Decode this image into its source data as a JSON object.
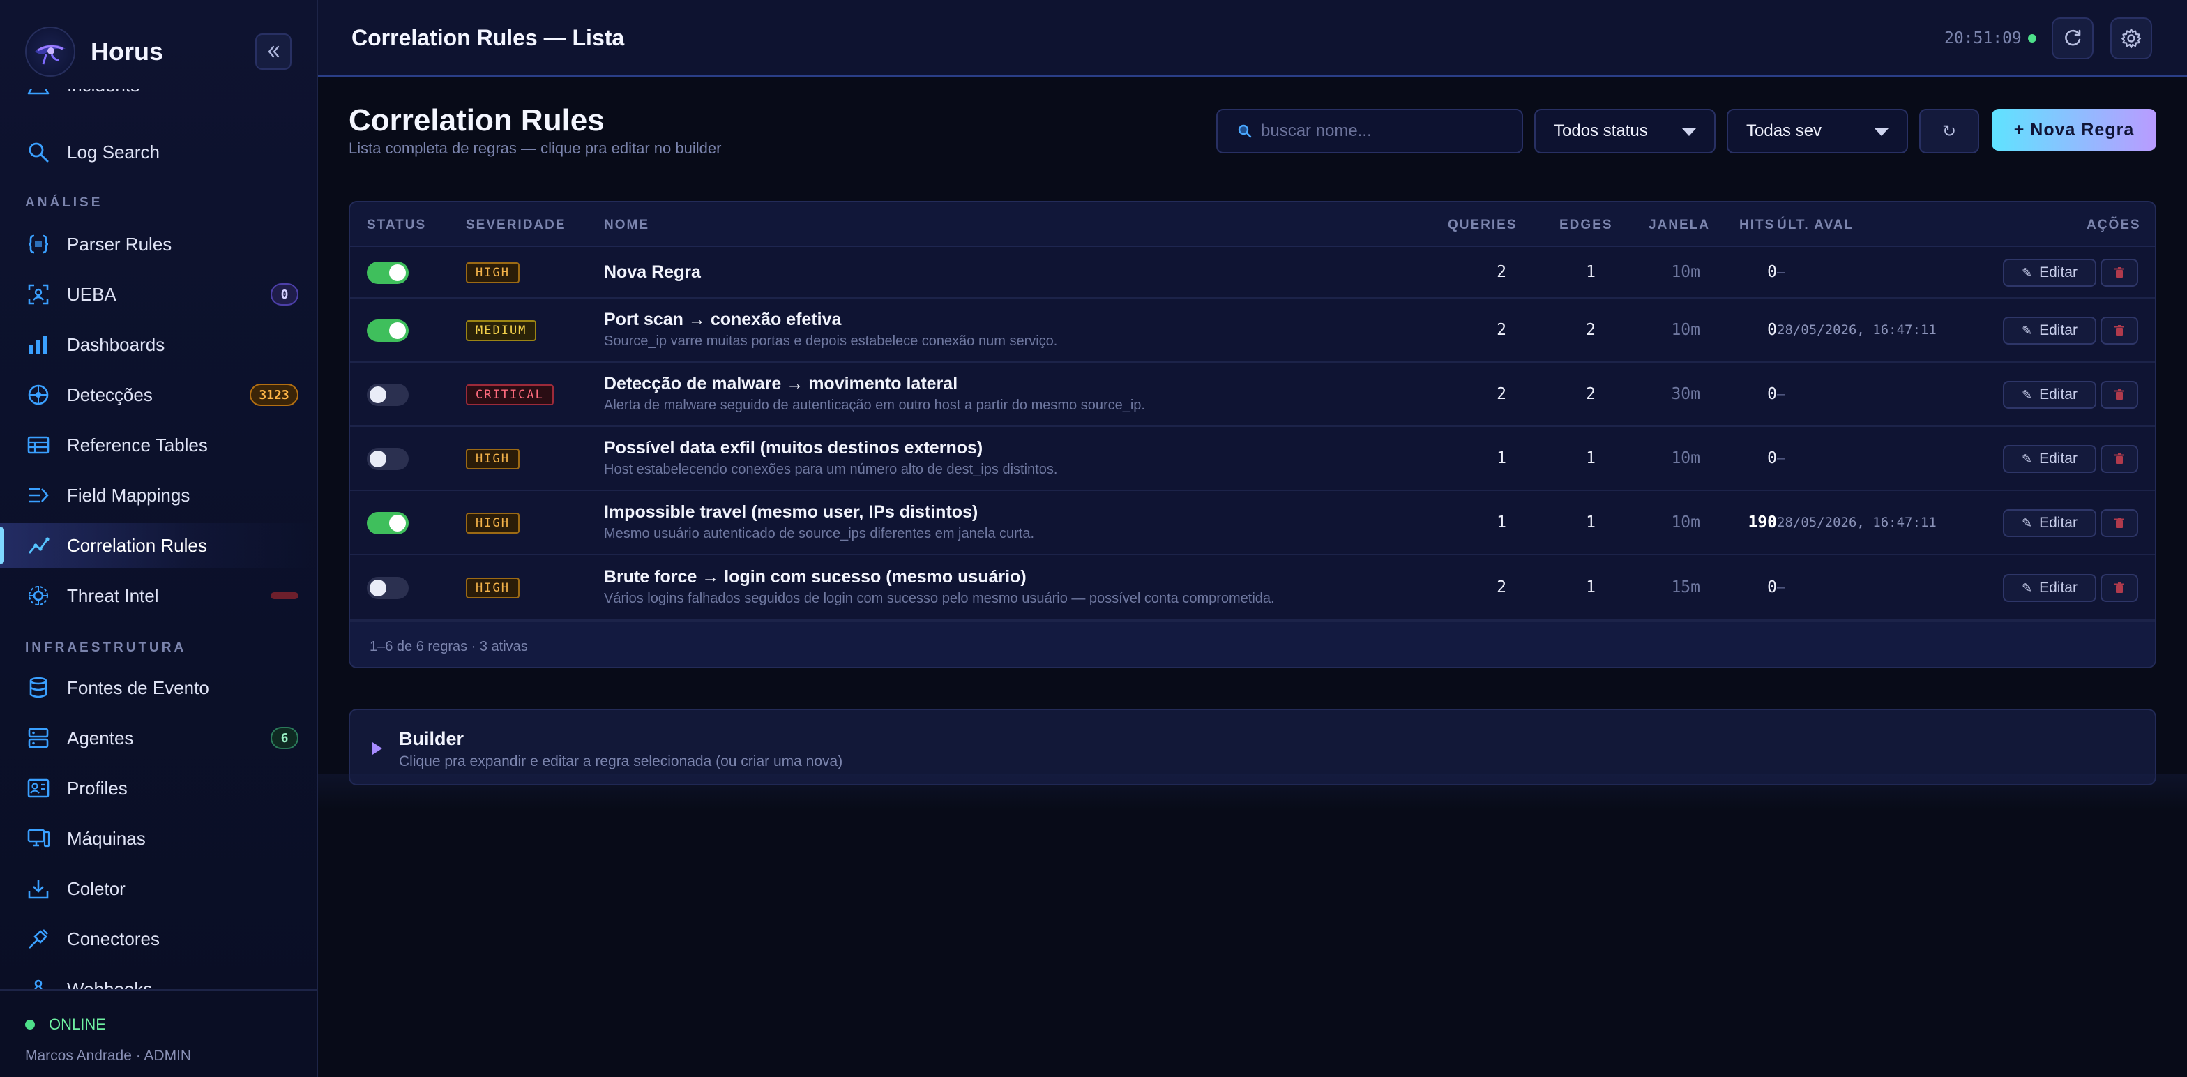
{
  "app": {
    "name": "Horus"
  },
  "sidebar": {
    "items": [
      {
        "label": "Incidents",
        "icon": "warning-icon"
      },
      {
        "label": "Log Search",
        "icon": "search-icon"
      },
      {
        "label": "Parser Rules",
        "icon": "braces-icon"
      },
      {
        "label": "UEBA",
        "icon": "user-focus-icon",
        "badge": "0"
      },
      {
        "label": "Dashboards",
        "icon": "bar-chart-icon"
      },
      {
        "label": "Detecções",
        "icon": "radar-icon",
        "badge": "3123"
      },
      {
        "label": "Reference Tables",
        "icon": "table-icon"
      },
      {
        "label": "Field Mappings",
        "icon": "mapping-icon"
      },
      {
        "label": "Correlation Rules",
        "icon": "trend-line-icon"
      },
      {
        "label": "Threat Intel",
        "icon": "biohazard-icon"
      },
      {
        "label": "Fontes de Evento",
        "icon": "database-icon"
      },
      {
        "label": "Agentes",
        "icon": "server-icon",
        "badge": "6"
      },
      {
        "label": "Profiles",
        "icon": "id-card-icon"
      },
      {
        "label": "Máquinas",
        "icon": "monitor-icon"
      },
      {
        "label": "Coletor",
        "icon": "inbox-download-icon"
      },
      {
        "label": "Conectores",
        "icon": "plug-icon"
      },
      {
        "label": "Webhooks",
        "icon": "webhook-icon"
      }
    ],
    "sections": {
      "analise": "ANÁLISE",
      "infra": "INFRAESTRUTURA"
    },
    "footer": {
      "status": "ONLINE",
      "user": "Marcos Andrade · ADMIN"
    }
  },
  "topbar": {
    "title": "Correlation Rules — Lista",
    "clock": "20:51:09"
  },
  "page": {
    "title": "Correlation Rules",
    "subtitle": "Lista completa de regras — clique pra editar no builder"
  },
  "filters": {
    "search_placeholder": "buscar nome...",
    "status_select": "Todos status",
    "sev_select": "Todas sev",
    "refresh_label": "↻",
    "new_rule_label": "+ Nova Regra"
  },
  "table": {
    "headers": {
      "status": "STATUS",
      "severity": "SEVERIDADE",
      "name": "NOME",
      "queries": "QUERIES",
      "edges": "EDGES",
      "window": "JANELA",
      "hits": "HITS",
      "last_eval": "ÚLT. AVAL",
      "actions": "AÇÕES"
    },
    "edit_label": "Editar",
    "rows": [
      {
        "enabled": true,
        "severity": "HIGH",
        "name": "Nova Regra",
        "description": "",
        "queries": "2",
        "edges": "1",
        "window": "10m",
        "hits": "0",
        "last_eval": "—"
      },
      {
        "enabled": true,
        "severity": "MEDIUM",
        "name": "Port scan → conexão efetiva",
        "description": "Source_ip varre muitas portas e depois estabelece conexão num serviço.",
        "queries": "2",
        "edges": "2",
        "window": "10m",
        "hits": "0",
        "last_eval": "28/05/2026, 16:47:11"
      },
      {
        "enabled": false,
        "severity": "CRITICAL",
        "name": "Detecção de malware → movimento lateral",
        "description": "Alerta de malware seguido de autenticação em outro host a partir do mesmo source_ip.",
        "queries": "2",
        "edges": "2",
        "window": "30m",
        "hits": "0",
        "last_eval": "—"
      },
      {
        "enabled": false,
        "severity": "HIGH",
        "name": "Possível data exfil (muitos destinos externos)",
        "description": "Host estabelecendo conexões para um número alto de dest_ips distintos.",
        "queries": "1",
        "edges": "1",
        "window": "10m",
        "hits": "0",
        "last_eval": "—"
      },
      {
        "enabled": true,
        "severity": "HIGH",
        "name": "Impossible travel (mesmo user, IPs distintos)",
        "description": "Mesmo usuário autenticado de source_ips diferentes em janela curta.",
        "queries": "1",
        "edges": "1",
        "window": "10m",
        "hits": "190",
        "last_eval": "28/05/2026, 16:47:11"
      },
      {
        "enabled": false,
        "severity": "HIGH",
        "name": "Brute force → login com sucesso (mesmo usuário)",
        "description": "Vários logins falhados seguidos de login com sucesso pelo mesmo usuário — possível conta comprometida.",
        "queries": "2",
        "edges": "1",
        "window": "15m",
        "hits": "0",
        "last_eval": "—"
      }
    ],
    "footer": "1–6 de 6 regras · 3 ativas"
  },
  "builder": {
    "title": "Builder",
    "subtitle": "Clique pra expandir e editar a regra selecionada (ou criar uma nova)"
  },
  "colors": {
    "accent_cyan": "#5fe3ff",
    "accent_purple": "#b99bff",
    "online_green": "#4ee08a",
    "high": "#f4b34a",
    "medium": "#f1cf4a",
    "critical": "#ff6b7e"
  }
}
